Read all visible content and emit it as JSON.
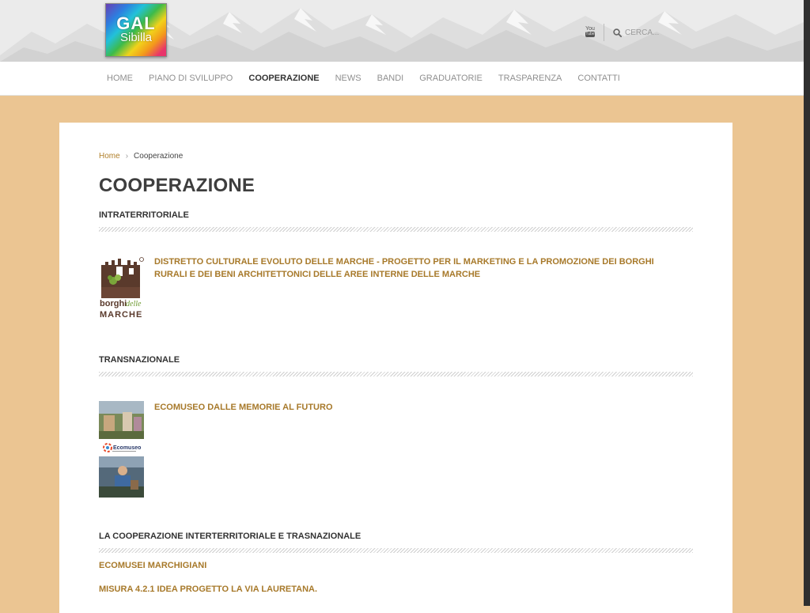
{
  "header": {
    "logo": {
      "line1": "GAL",
      "line2": "Sibilla"
    },
    "youtube": {
      "top": "You",
      "bottom": "Tube"
    },
    "search": {
      "placeholder": "CERCA..."
    }
  },
  "nav": {
    "items": [
      {
        "label": "HOME"
      },
      {
        "label": "PIANO DI SVILUPPO"
      },
      {
        "label": "COOPERAZIONE",
        "active": true
      },
      {
        "label": "NEWS"
      },
      {
        "label": "BANDI"
      },
      {
        "label": "GRADUATORIE"
      },
      {
        "label": "TRASPARENZA"
      },
      {
        "label": "CONTATTI"
      }
    ]
  },
  "breadcrumb": {
    "home": "Home",
    "separator": "›",
    "current": "Cooperazione"
  },
  "page": {
    "title": "COOPERAZIONE"
  },
  "sections": {
    "intraterritoriale": {
      "title": "INTRATERRITORIALE",
      "item": {
        "title": "DISTRETTO CULTURALE EVOLUTO DELLE MARCHE - PROGETTO PER IL MARKETING E LA PROMOZIONE DEI BORGHI RURALI E DEI BENI ARCHITETTONICI DELLE AREE INTERNE DELLE MARCHE",
        "logo_text": {
          "borghi": "borghi",
          "delle": "delle",
          "marche": "MARCHE"
        }
      }
    },
    "transnazionale": {
      "title": "TRANSNAZIONALE",
      "item": {
        "title": "ECOMUSEO DALLE MEMORIE AL FUTURO",
        "logo_text": "Ecomuseo"
      }
    },
    "interterritoriale": {
      "title": "LA COOPERAZIONE INTERTERRITORIALE E TRASNAZIONALE",
      "links": [
        "ECOMUSEI MARCHIGIANI",
        "MISURA 4.2.1 IDEA PROGETTO LA VIA LAURETANA."
      ]
    }
  },
  "colors": {
    "background": "#ebc592",
    "accent_link": "#a7792a",
    "title": "#3e3e3e"
  }
}
